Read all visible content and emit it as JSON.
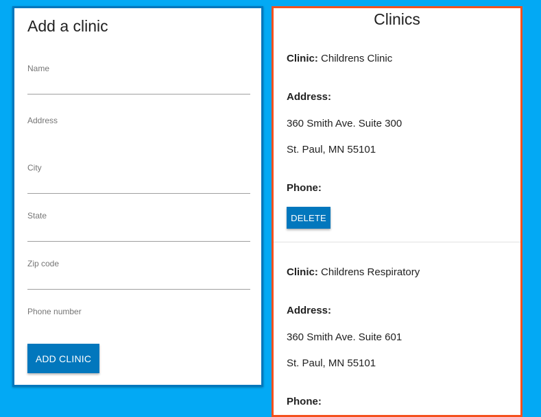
{
  "form": {
    "title": "Add a clinic",
    "fields": [
      {
        "label": "Name",
        "value": ""
      },
      {
        "label": "Address",
        "value": ""
      },
      {
        "label": "City",
        "value": ""
      },
      {
        "label": "State",
        "value": ""
      },
      {
        "label": "Zip code",
        "value": ""
      },
      {
        "label": "Phone number",
        "value": ""
      }
    ],
    "submit_label": "ADD CLINIC"
  },
  "list": {
    "title": "Clinics",
    "clinic_label": "Clinic:",
    "address_label": "Address:",
    "phone_label": "Phone:",
    "delete_label": "DELETE",
    "clinics": [
      {
        "name": "Childrens Clinic",
        "address_line1": "360 Smith Ave. Suite 300",
        "address_line2": "St. Paul, MN 55101"
      },
      {
        "name": "Childrens Respiratory",
        "address_line1": "360 Smith Ave. Suite 601",
        "address_line2": "St. Paul, MN 55101"
      }
    ]
  },
  "colors": {
    "background": "#03a9f4",
    "form_border": "#0277bd",
    "list_border": "#f4511e",
    "button": "#0277bd"
  }
}
